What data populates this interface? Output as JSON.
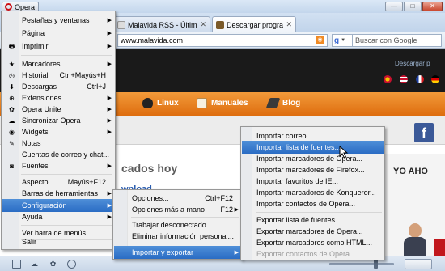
{
  "window": {
    "opera_button": "Opera",
    "minimize_glyph": "—",
    "maximize_glyph": "□",
    "close_glyph": "✕"
  },
  "tabs": [
    {
      "label": "Malavida RSS - Última ...",
      "close": "✕"
    },
    {
      "label": "Descargar programas g...",
      "close": "✕"
    }
  ],
  "new_tab_glyph": "+",
  "address": {
    "url": "www.malavida.com",
    "search_engine_glyph": "g",
    "search_placeholder": "Buscar con Google"
  },
  "page": {
    "lang_label": "Descargar p",
    "nav": [
      {
        "label": "Linux"
      },
      {
        "label": "Manuales"
      },
      {
        "label": "Blog"
      }
    ],
    "facebook_glyph": "f",
    "hot_title": "cados hoy",
    "download_label": "wnload",
    "ad_text": "YO AHO"
  },
  "main_menu": {
    "items": [
      {
        "label": "Pestañas y ventanas",
        "shortcut": "",
        "arrow": "▶"
      },
      {
        "label": "Página",
        "shortcut": "",
        "arrow": "▶"
      },
      {
        "label": "Imprimir",
        "shortcut": "",
        "arrow": "▶",
        "icon": "🖶"
      },
      {
        "label": "Marcadores",
        "shortcut": "",
        "arrow": "▶",
        "icon": "★"
      },
      {
        "label": "Historial",
        "shortcut": "Ctrl+Mayús+H",
        "arrow": "",
        "icon": "◷"
      },
      {
        "label": "Descargas",
        "shortcut": "Ctrl+J",
        "arrow": "",
        "icon": "⬇"
      },
      {
        "label": "Extensiones",
        "shortcut": "",
        "arrow": "▶",
        "icon": "⊕"
      },
      {
        "label": "Opera Unite",
        "shortcut": "",
        "arrow": "▶",
        "icon": "✿"
      },
      {
        "label": "Sincronizar Opera",
        "shortcut": "",
        "arrow": "▶",
        "icon": "☁"
      },
      {
        "label": "Widgets",
        "shortcut": "",
        "arrow": "▶",
        "icon": "◉"
      },
      {
        "label": "Notas",
        "shortcut": "",
        "arrow": "",
        "icon": "✎"
      },
      {
        "label": "Cuentas de correo y chat...",
        "shortcut": "",
        "arrow": ""
      },
      {
        "label": "Fuentes",
        "shortcut": "",
        "arrow": "▶",
        "icon": "◙"
      },
      {
        "label": "Aspecto...",
        "shortcut": "Mayús+F12",
        "arrow": ""
      },
      {
        "label": "Barras de herramientas",
        "shortcut": "",
        "arrow": "▶"
      },
      {
        "label": "Configuración",
        "shortcut": "",
        "arrow": "▶"
      },
      {
        "label": "Ayuda",
        "shortcut": "",
        "arrow": "▶"
      },
      {
        "label": "Ver barra de menús",
        "shortcut": "",
        "arrow": ""
      },
      {
        "label": "Salir",
        "shortcut": "",
        "arrow": ""
      }
    ]
  },
  "config_menu": {
    "items": [
      {
        "label": "Opciones...",
        "shortcut": "Ctrl+F12",
        "arrow": ""
      },
      {
        "label": "Opciones más a mano",
        "shortcut": "F12",
        "arrow": "▶"
      },
      {
        "label": "Trabajar desconectado",
        "shortcut": "",
        "arrow": ""
      },
      {
        "label": "Eliminar información personal...",
        "shortcut": "",
        "arrow": ""
      },
      {
        "label": "Importar y exportar",
        "shortcut": "",
        "arrow": "▶"
      }
    ]
  },
  "import_menu": {
    "items": [
      {
        "label": "Importar correo..."
      },
      {
        "label": "Importar lista de fuentes..."
      },
      {
        "label": "Importar marcadores de Opera..."
      },
      {
        "label": "Importar marcadores de Firefox..."
      },
      {
        "label": "Importar favoritos de IE..."
      },
      {
        "label": "Importar marcadores de Konqueror..."
      },
      {
        "label": "Importar contactos de Opera..."
      },
      {
        "label": "Exportar lista de fuentes..."
      },
      {
        "label": "Exportar marcadores de Opera..."
      },
      {
        "label": "Exportar marcadores como HTML..."
      },
      {
        "label": "Exportar contactos de Opera..."
      }
    ]
  },
  "colors": {
    "menu_highlight": "#2a6cc4",
    "opera_red": "#cc0f16",
    "site_orange": "#de6d0e"
  }
}
